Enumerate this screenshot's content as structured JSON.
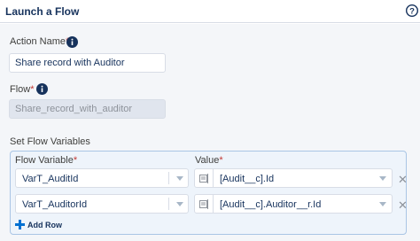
{
  "header": {
    "title": "Launch a Flow"
  },
  "action_name": {
    "label": "Action Name",
    "required_mark": "*",
    "value": "Share record with Auditor"
  },
  "flow": {
    "label": "Flow",
    "required_mark": "*",
    "value": "Share_record_with_auditor"
  },
  "variables": {
    "section_label": "Set Flow Variables",
    "col_variable": "Flow Variable",
    "col_value": "Value",
    "required_mark": "*",
    "rows": [
      {
        "variable": "VarT_AuditId",
        "value": "[Audit__c].Id"
      },
      {
        "variable": "VarT_AuditorId",
        "value": "[Audit__c].Auditor__r.Id"
      }
    ],
    "add_row_label": "Add Row"
  },
  "colors": {
    "accent": "#0070d2",
    "required": "#c23934",
    "panel": "#f4f6f9"
  }
}
